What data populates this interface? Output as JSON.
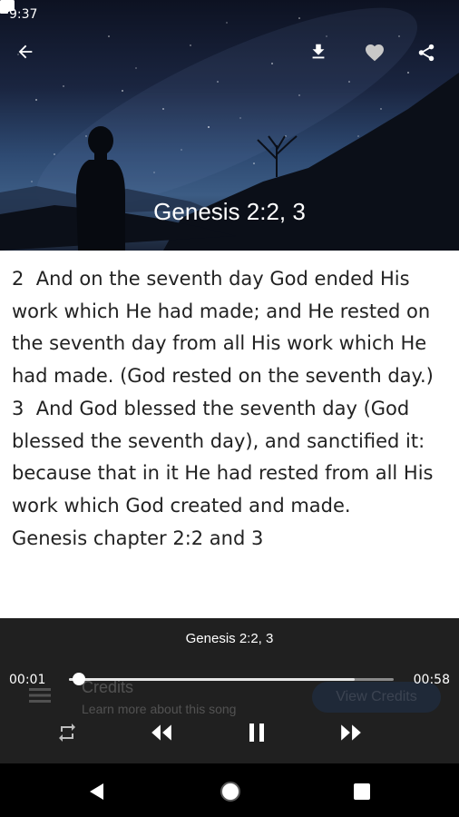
{
  "status_bar": {
    "time": "9:37",
    "left_icons": [
      "youtube-icon",
      "gmail-icon",
      "youtube-icon",
      "cloud-icon"
    ],
    "right_icons": [
      "data-saver-icon",
      "wifi-icon",
      "battery-icon"
    ]
  },
  "header": {
    "title": "Genesis 2:2, 3",
    "actions": [
      "back-arrow-icon",
      "download-icon",
      "heart-icon",
      "share-icon"
    ]
  },
  "lyrics": {
    "text": "2  And on the seventh day God ended His work which He had made; and He rested on the seventh day from all His work which He had made. (God rested on the seventh day.)\n3  And God blessed the seventh day (God blessed the seventh day), and sanctified it: because that in it He had rested from all His work which God created and made.\nGenesis chapter 2:2 and 3"
  },
  "player": {
    "track_title": "Genesis 2:2, 3",
    "elapsed": "00:01",
    "duration": "00:58",
    "progress_fraction": 0.03,
    "buffered_fraction": 0.88,
    "controls": [
      "repeat-icon",
      "rewind-icon",
      "pause-icon",
      "fast-forward-icon"
    ]
  },
  "background_credits": {
    "title": "Credits",
    "subtitle": "Learn more about this song",
    "button_label": "View Credits"
  },
  "navbar": {
    "buttons": [
      "back-triangle-icon",
      "home-circle-icon",
      "recents-square-icon"
    ]
  }
}
